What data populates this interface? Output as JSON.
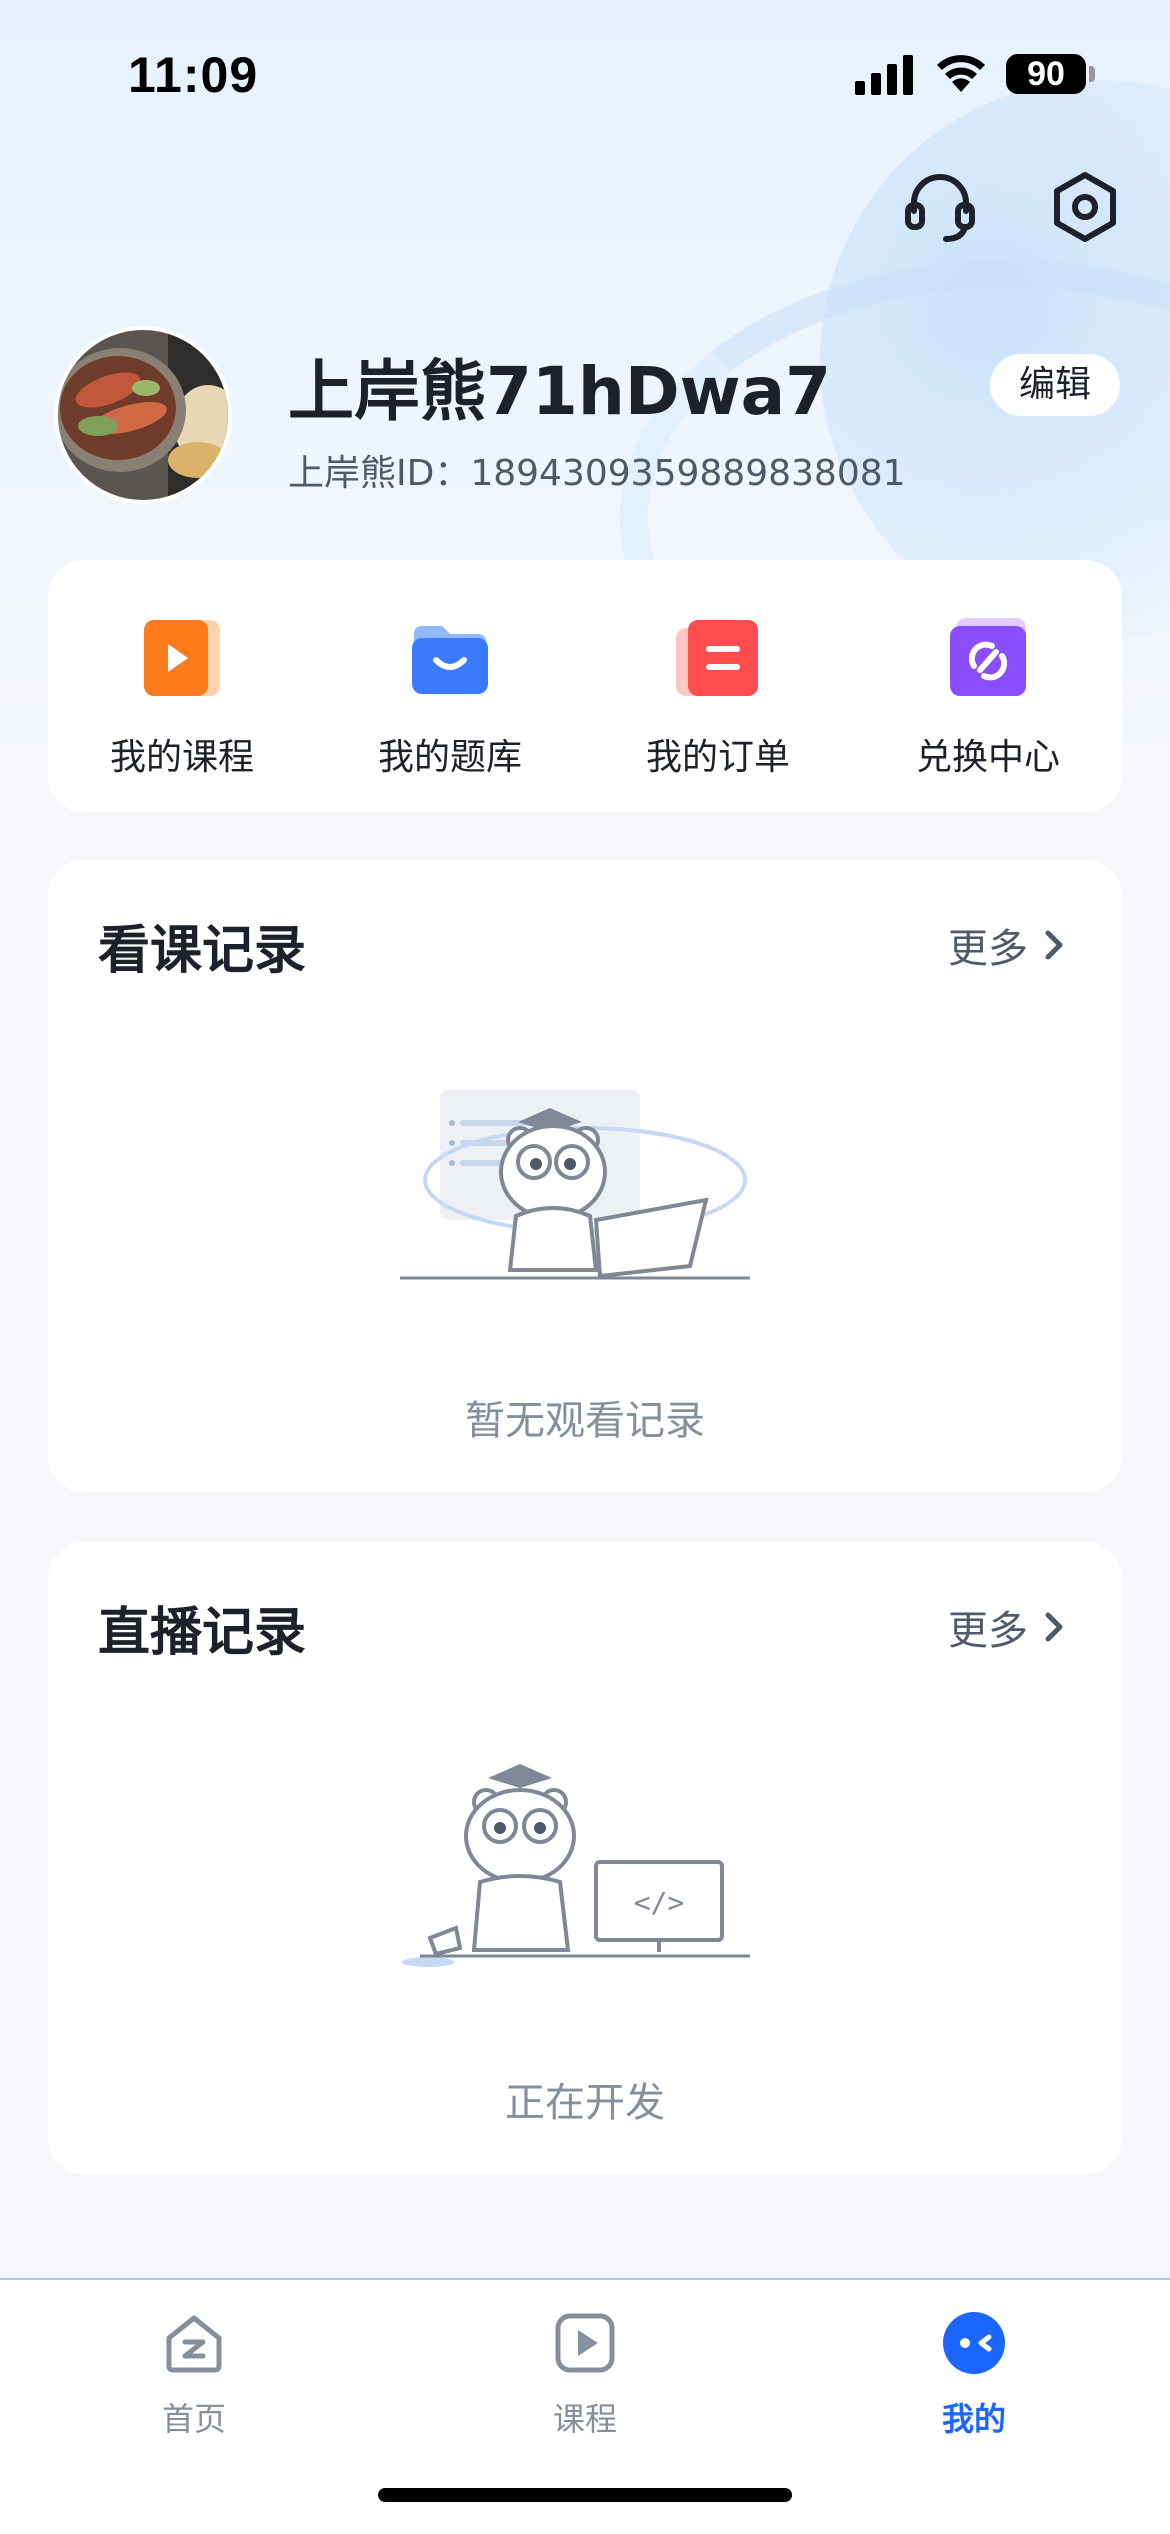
{
  "status_bar": {
    "time": "11:09",
    "battery": "90"
  },
  "header": {
    "icons": [
      "headset-icon",
      "settings-icon"
    ]
  },
  "profile": {
    "username": "上岸熊71hDwa7",
    "id_label": "上岸熊ID：",
    "id_value": "1894309359889838081",
    "edit_label": "编辑"
  },
  "quick_actions": [
    {
      "label": "我的课程",
      "icon": "play-icon",
      "color": "#ff7a1a"
    },
    {
      "label": "我的题库",
      "icon": "folder-icon",
      "color": "#3a7bff"
    },
    {
      "label": "我的订单",
      "icon": "order-icon",
      "color": "#ff4d4f"
    },
    {
      "label": "兑换中心",
      "icon": "exchange-icon",
      "color": "#8a4dff"
    }
  ],
  "watch_record": {
    "title": "看课记录",
    "more": "更多",
    "empty": "暂无观看记录"
  },
  "live_record": {
    "title": "直播记录",
    "more": "更多",
    "empty": "正在开发"
  },
  "tabs": [
    {
      "label": "首页",
      "icon": "home-icon",
      "active": false
    },
    {
      "label": "课程",
      "icon": "course-play-icon",
      "active": false
    },
    {
      "label": "我的",
      "icon": "profile-face-icon",
      "active": true
    }
  ],
  "colors": {
    "accent": "#1a66ff",
    "text_primary": "#1d2129",
    "text_secondary": "#86909c"
  }
}
